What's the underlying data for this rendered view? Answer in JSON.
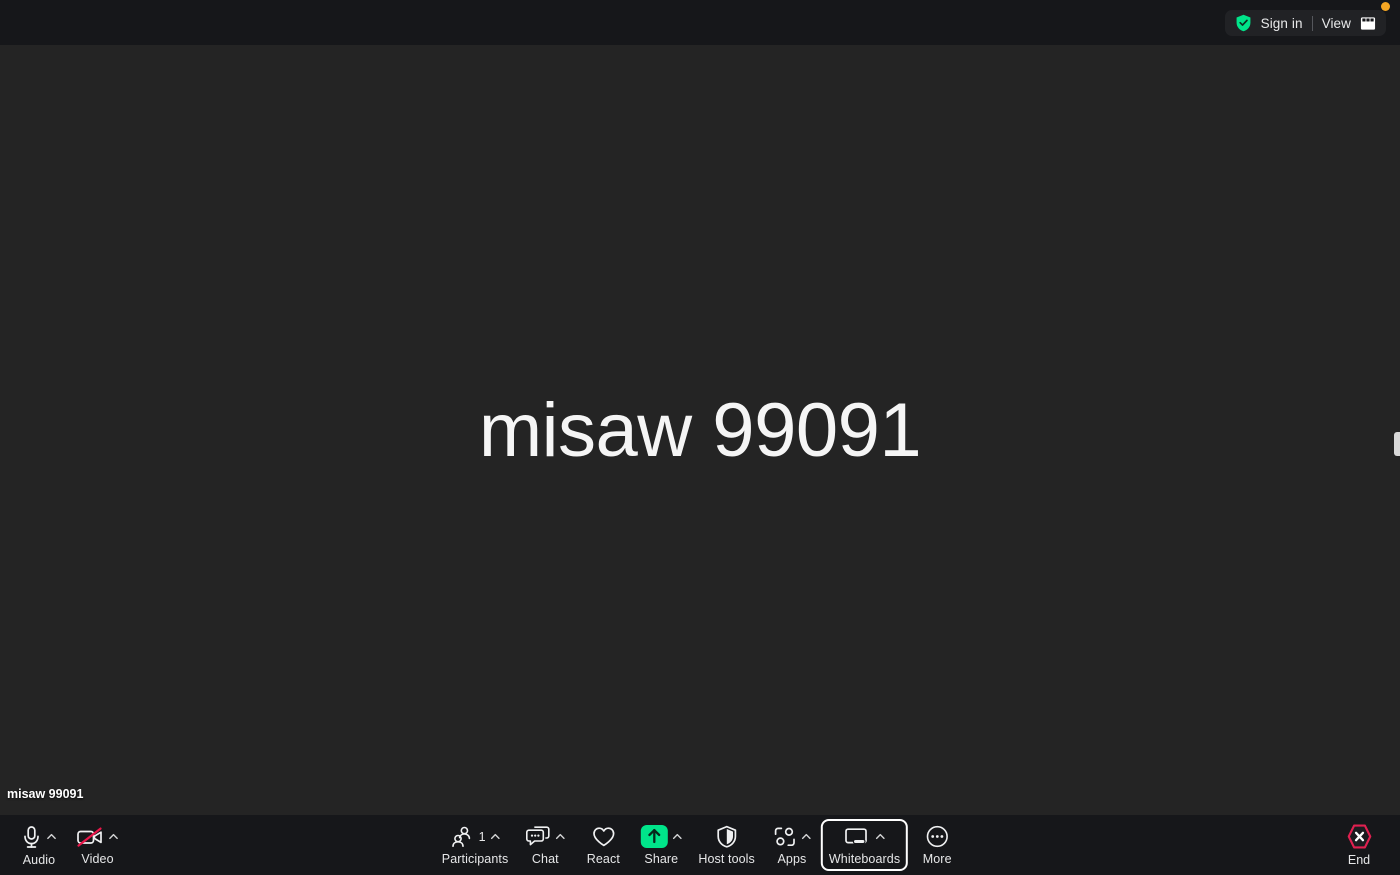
{
  "header": {
    "sign_in_label": "Sign in",
    "divider": "|",
    "view_label": "View",
    "shield_icon": "shield-check-icon",
    "view_icon": "gallery-view-icon",
    "status_dot": "recording-indicator-dot",
    "colors": {
      "bar_bg": "#16171a",
      "pill_bg": "#212225",
      "shield_green": "#00e58a",
      "dot_orange": "#f5a623"
    }
  },
  "stage": {
    "participant_name_large": "misaw 99091",
    "participant_name_corner": "misaw 99091",
    "background": "#242424",
    "side_panel_handle": "panel-drag-handle"
  },
  "toolbar": {
    "background": "#16171a",
    "left_items": [
      {
        "label": "Audio",
        "icon": "microphone-icon",
        "has_chevron": true,
        "muted": false
      },
      {
        "label": "Video",
        "icon": "camera-off-icon",
        "has_chevron": true,
        "muted": true
      }
    ],
    "center_items": [
      {
        "label": "Participants",
        "icon": "participants-icon",
        "count": "1",
        "has_chevron": true
      },
      {
        "label": "Chat",
        "icon": "chat-bubble-icon",
        "has_chevron": true
      },
      {
        "label": "React",
        "icon": "heart-icon",
        "has_chevron": false
      },
      {
        "label": "Share",
        "icon": "share-screen-icon",
        "has_chevron": true,
        "accent": "#00e58a"
      },
      {
        "label": "Host tools",
        "icon": "shield-icon",
        "has_chevron": false
      },
      {
        "label": "Apps",
        "icon": "apps-icon",
        "has_chevron": true
      },
      {
        "label": "Whiteboards",
        "icon": "whiteboard-icon",
        "has_chevron": true,
        "focused": true
      },
      {
        "label": "More",
        "icon": "ellipsis-icon",
        "has_chevron": false
      }
    ],
    "end_button": {
      "label": "End",
      "icon": "end-call-icon",
      "color": "#e02050"
    }
  }
}
